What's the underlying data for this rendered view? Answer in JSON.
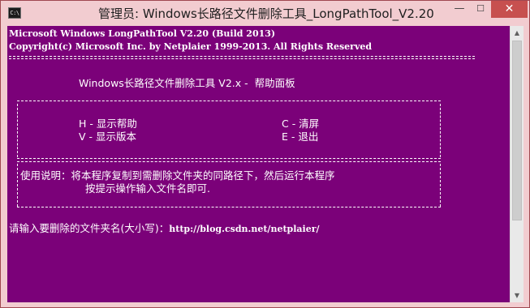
{
  "window": {
    "title": "管理员:  Windows长路径文件删除工具_LongPathTool_V2.20",
    "icon_text": "C:\\",
    "minimize_glyph": "—",
    "maximize_glyph": "☐",
    "close_glyph": "✕",
    "console_bg": "#7b0179",
    "titlebar_bg": "#f2ccd0",
    "close_bg": "#c7504f"
  },
  "console": {
    "banner1": "Microsoft Windows LongPathTool V2.20 (Build 2013)",
    "banner2": "Copyright(c) Microsoft Inc. by Netplaier 1999-2013. All Rights Reserved",
    "panel_title": "Windows长路径文件删除工具 V2.x -  帮助面板",
    "cmd_h": "H - 显示帮助",
    "cmd_c": "C - 清屏",
    "cmd_v": "V - 显示版本",
    "cmd_e": "E - 退出",
    "usage1": "使用说明：将本程序复制到需删除文件夹的同路径下，然后运行本程序",
    "usage2": "按提示操作输入文件名即可.",
    "prompt": "请输入要删除的文件夹名(大小写)：",
    "prompt_url": "http://blog.csdn.net/netplaier/"
  },
  "scrollbar": {
    "up_icon": "▲",
    "down_icon": "▼"
  }
}
